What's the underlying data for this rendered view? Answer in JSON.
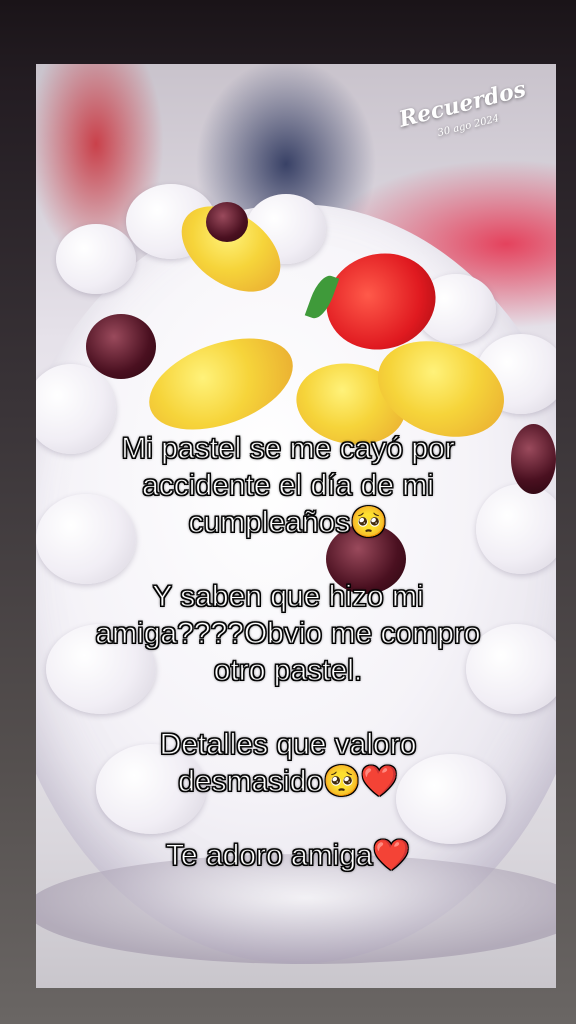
{
  "watermark": {
    "title": "Recuerdos",
    "date": "30 ago 2024"
  },
  "caption": {
    "line1": "Mi pastel se me cayó por",
    "line2": "accidente el día de mi",
    "line3": "cumpleaños🥺",
    "line4": "Y saben que hizo mi",
    "line5": "amiga????Obvio me compro",
    "line6": "otro pastel.",
    "line7": "Detalles que valoro",
    "line8": "desmasido🥺❤️",
    "line9": "Te adoro amiga❤️"
  }
}
